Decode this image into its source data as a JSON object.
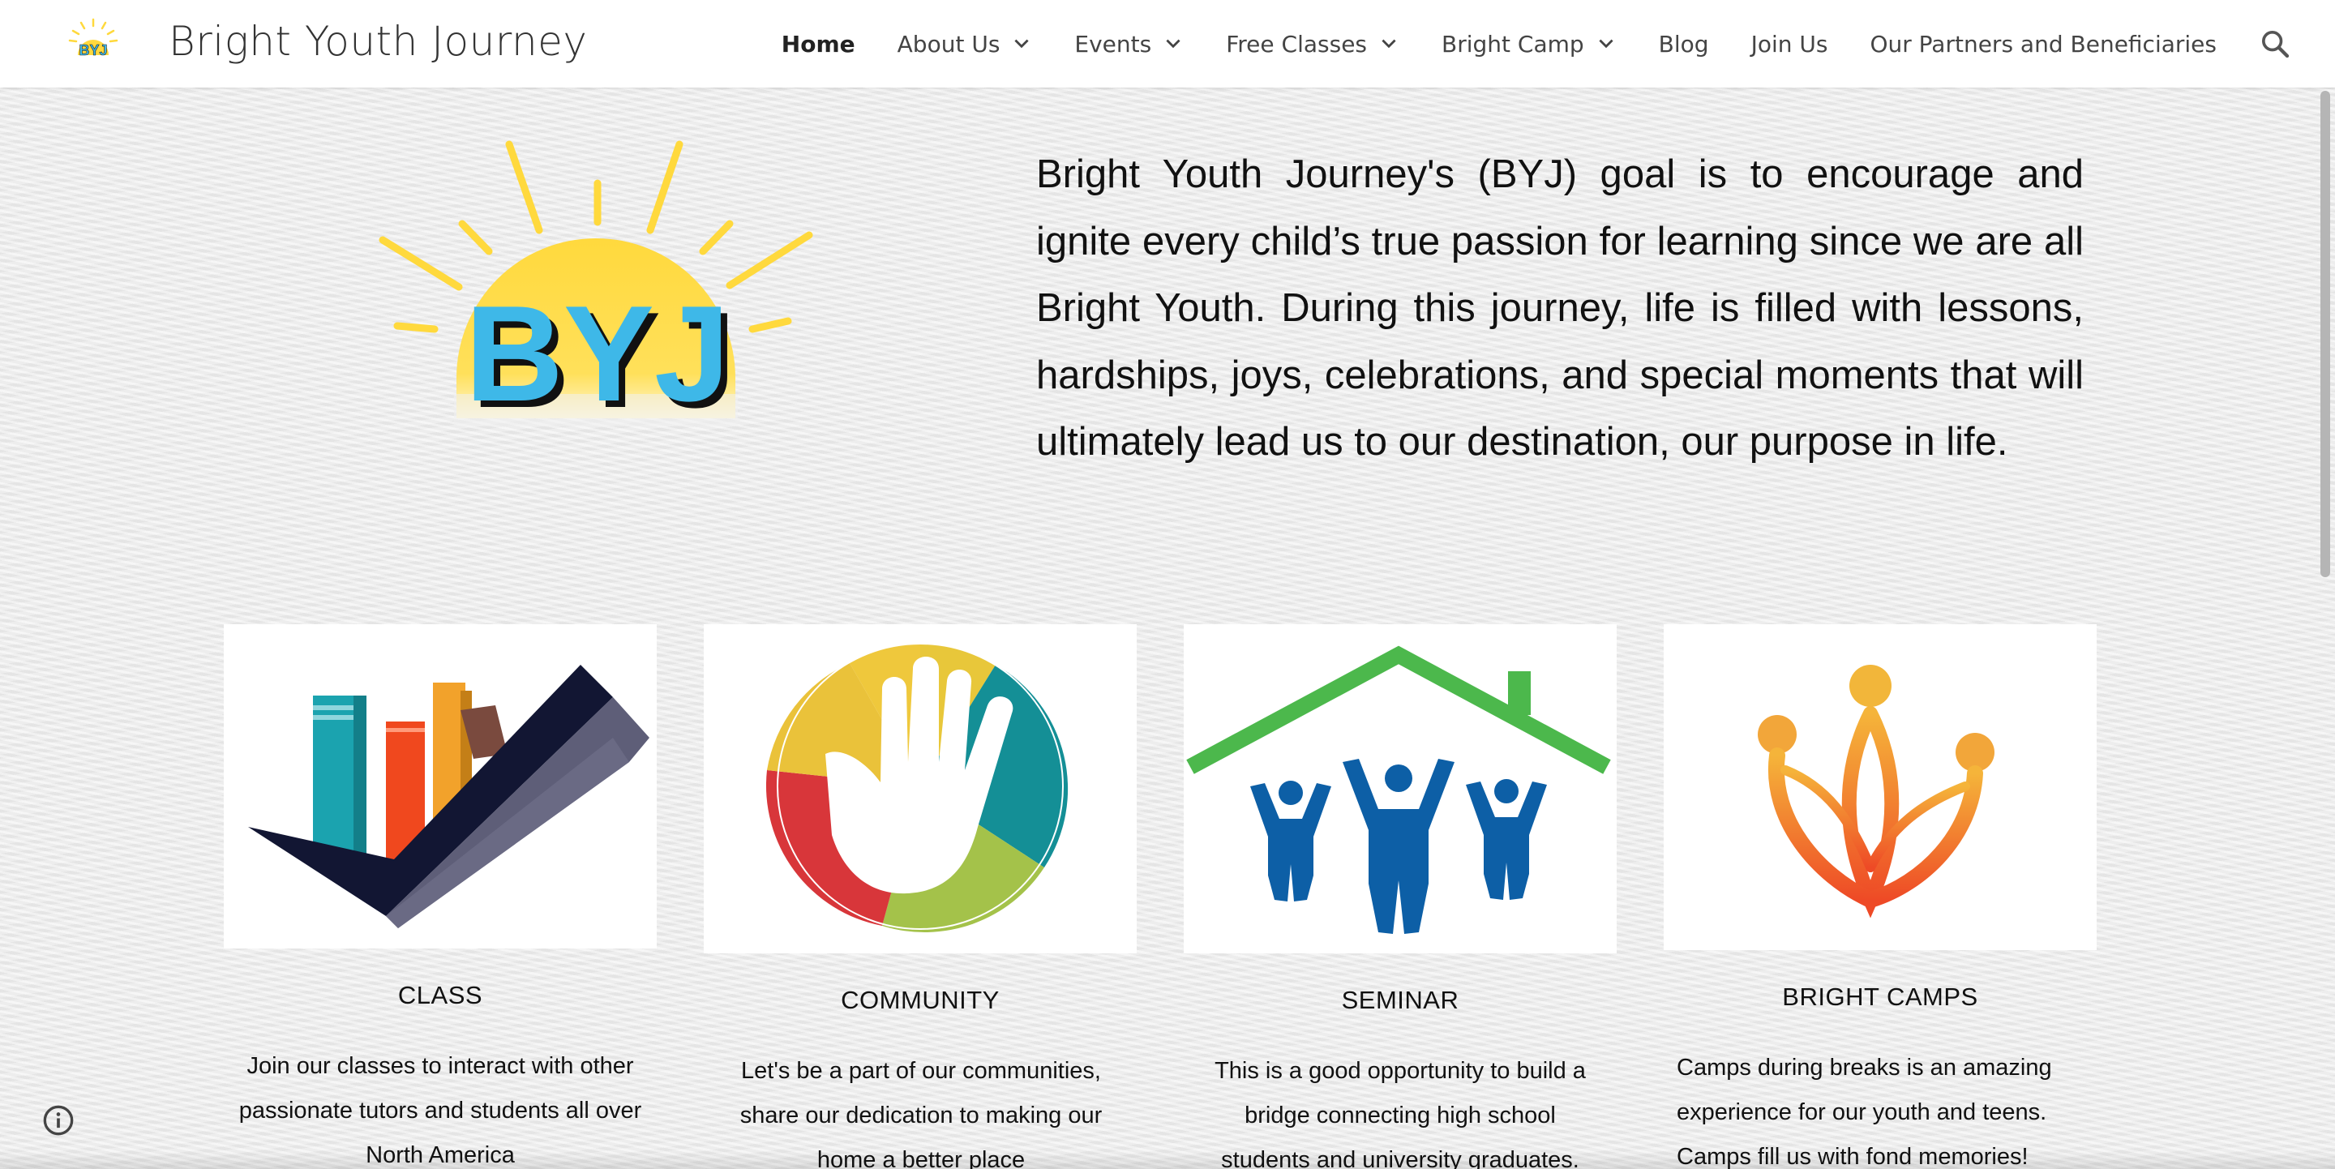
{
  "site": {
    "logo_text": "BYJ",
    "title": "Bright Youth Journey"
  },
  "nav": {
    "items": [
      {
        "label": "Home",
        "active": true,
        "has_dropdown": false
      },
      {
        "label": "About Us",
        "active": false,
        "has_dropdown": true
      },
      {
        "label": "Events",
        "active": false,
        "has_dropdown": true
      },
      {
        "label": "Free Classes",
        "active": false,
        "has_dropdown": true
      },
      {
        "label": "Bright Camp",
        "active": false,
        "has_dropdown": true
      },
      {
        "label": "Blog",
        "active": false,
        "has_dropdown": false
      },
      {
        "label": "Join Us",
        "active": false,
        "has_dropdown": false
      },
      {
        "label": "Our Partners and Beneficiaries",
        "active": false,
        "has_dropdown": false
      }
    ],
    "search_icon": "search-icon"
  },
  "hero": {
    "logo_text": "BYJ",
    "mission": "Bright Youth Journey's (BYJ) goal is to encourage and ignite every child’s true passion for learning since we are all Bright Youth. During this journey, life is filled with lessons, hardships, joys, celebrations, and special moments that will ultimately lead us to our destination, our purpose in life."
  },
  "cards": [
    {
      "title": "CLASS",
      "description": "Join our classes to interact with other passionate tutors and students all over North America",
      "icon": "books-checkmark-icon"
    },
    {
      "title": "COMMUNITY",
      "description": "Let's be a part of our communities, share our dedication to making our home a better place",
      "icon": "hand-circle-icon"
    },
    {
      "title": "SEMINAR",
      "description": "This is a good opportunity to build a bridge connecting high school students and university graduates.",
      "icon": "house-people-icon"
    },
    {
      "title": "BRIGHT CAMPS",
      "description": "Camps during breaks is an amazing experience for our youth and teens. Camps fill us with fond memories!",
      "icon": "camp-figures-icon"
    }
  ],
  "colors": {
    "sun_yellow": "#FFD93D",
    "logo_blue": "#3EB8E8",
    "house_green": "#4CB84C",
    "people_blue": "#0D5FA6",
    "camp_orange": "#F07A2A"
  },
  "footer": {
    "info_icon": "info-icon"
  }
}
